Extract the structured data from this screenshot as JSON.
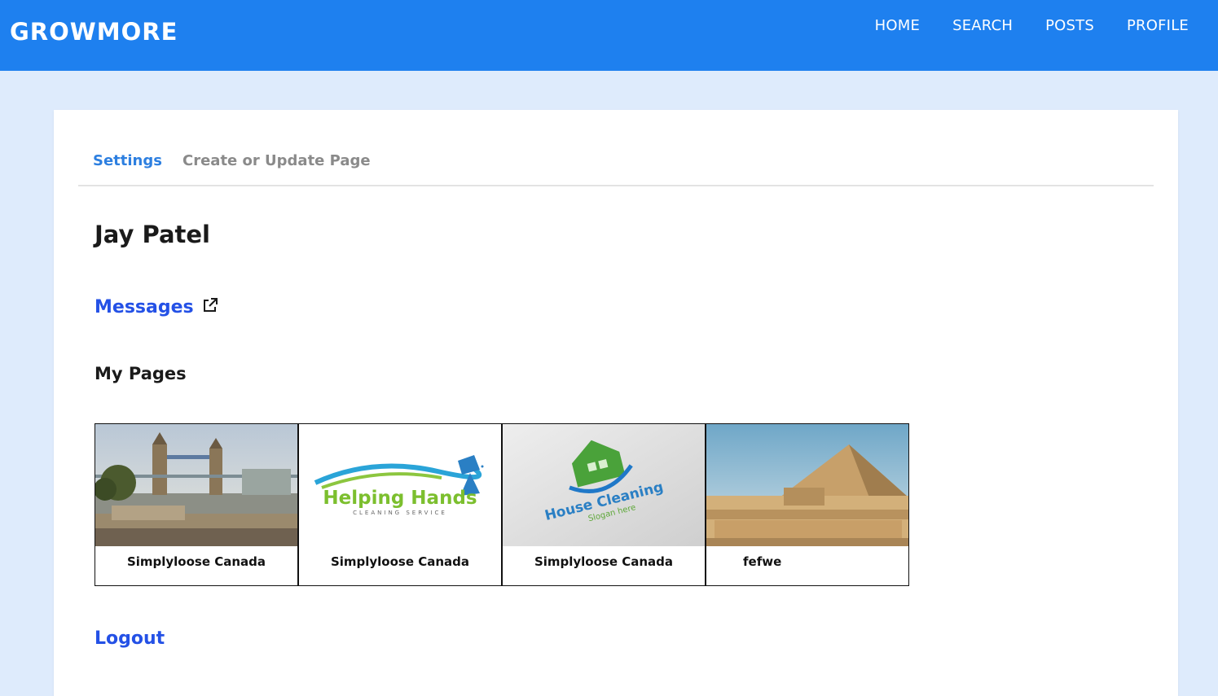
{
  "app": {
    "brand": "GROWMORE"
  },
  "nav": [
    {
      "label": "HOME"
    },
    {
      "label": "SEARCH"
    },
    {
      "label": "POSTS"
    },
    {
      "label": "PROFILE"
    }
  ],
  "tabs": {
    "settings": "Settings",
    "create_update": "Create or Update Page"
  },
  "profile": {
    "name": "Jay Patel",
    "messages_label": "Messages",
    "my_pages_heading": "My Pages",
    "logout_label": "Logout"
  },
  "pages": [
    {
      "title": "Simplyloose Canada",
      "image": "tower-bridge-photo"
    },
    {
      "title": "Simplyloose Canada",
      "image": "helping-hands-logo",
      "logo_main": "Helping Hands",
      "logo_sub": "CLEANING SERVICE"
    },
    {
      "title": "Simplyloose Canada",
      "image": "house-cleaning-logo",
      "logo_main": "House Cleaning",
      "logo_sub": "Slogan here"
    },
    {
      "title": "fefwe",
      "image": "pyramid-photo"
    }
  ],
  "colors": {
    "header": "#1e80ef",
    "background": "#deebfc",
    "link": "#2451e6",
    "active_tab": "#2d7fe0"
  }
}
